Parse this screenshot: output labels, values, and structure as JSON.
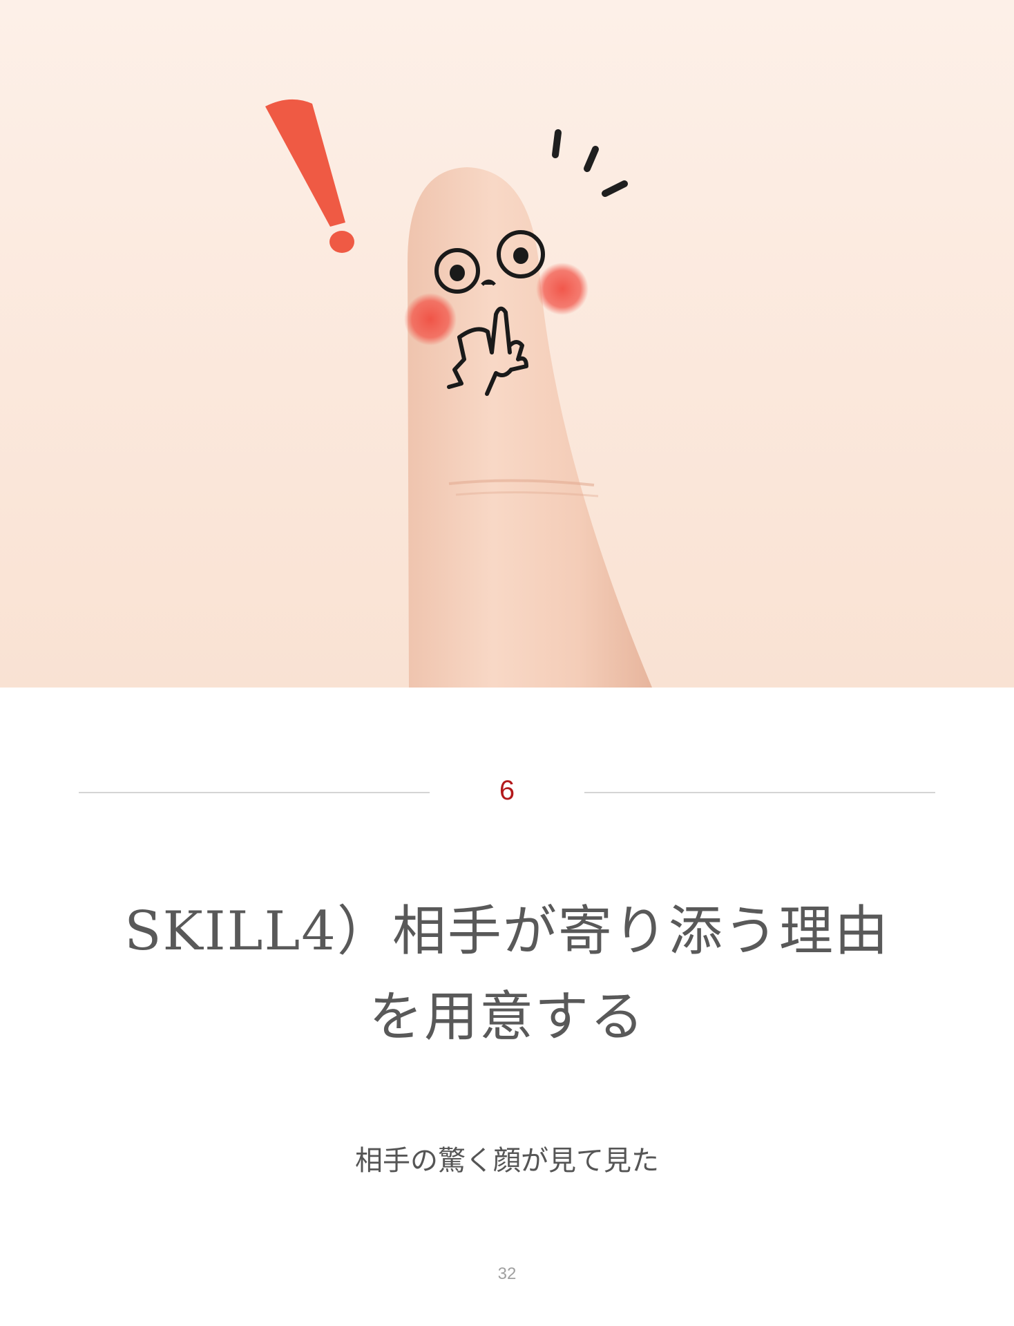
{
  "chapter": {
    "number": "6",
    "title_line1": "SKILL4）相手が寄り添う理由",
    "title_line2": "を用意する",
    "subtitle": "相手の驚く顔が見て見た"
  },
  "footer": {
    "page_number": "32"
  },
  "colors": {
    "accent": "#b3191b",
    "title_text": "#595959",
    "divider": "#d4d4d4",
    "exclamation": "#ef5a44",
    "blush": "#f2564a"
  },
  "illustration": {
    "subject": "finger-face",
    "expression": "surprised"
  }
}
